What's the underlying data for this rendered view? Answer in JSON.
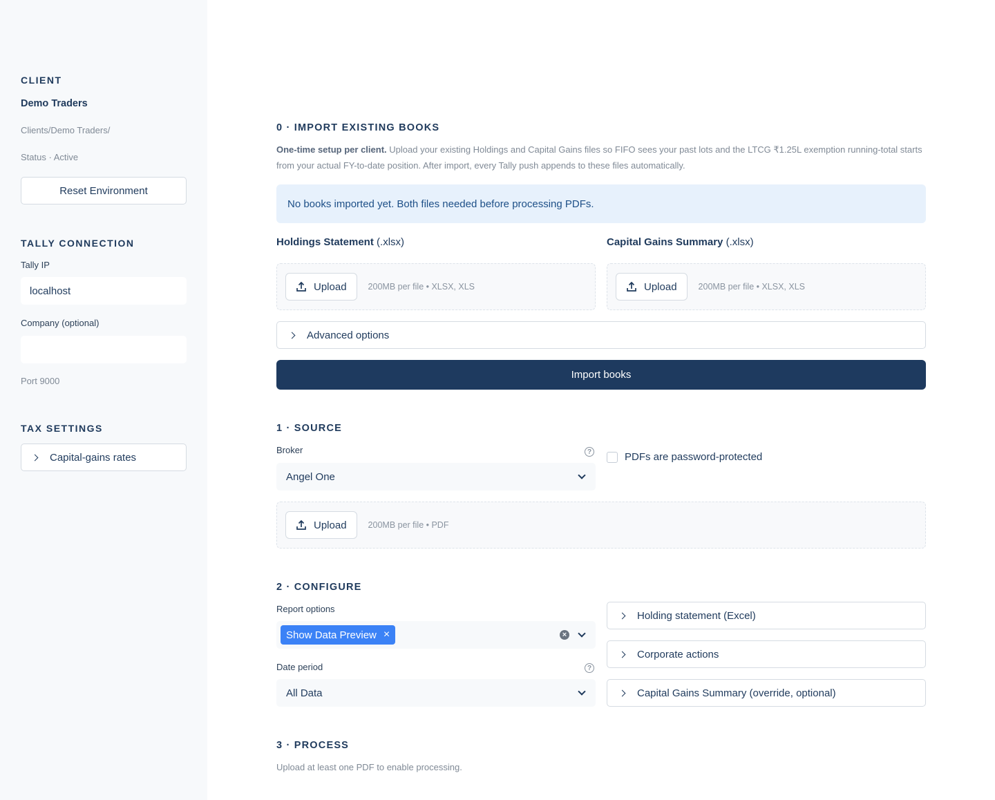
{
  "sidebar": {
    "client": {
      "heading": "CLIENT",
      "name": "Demo Traders",
      "path": "Clients/Demo Traders/",
      "status": "Status · Active",
      "reset_label": "Reset Environment"
    },
    "tally": {
      "heading": "TALLY CONNECTION",
      "ip_label": "Tally IP",
      "ip_value": "localhost",
      "company_label": "Company (optional)",
      "company_value": "",
      "port": "Port 9000"
    },
    "tax": {
      "heading": "TAX SETTINGS",
      "rates_label": "Capital-gains rates"
    }
  },
  "import_books": {
    "heading": "0 · IMPORT EXISTING BOOKS",
    "desc_bold": "One-time setup per client.",
    "desc_line1": " Upload your existing Holdings and Capital Gains files so FIFO sees your past lots and the LTCG ₹1.25L exemption running-total starts",
    "desc_line2": "from your actual FY-to-date position. After import, every Tally push appends to these files automatically.",
    "info": "No books imported yet. Both files needed before processing PDFs.",
    "holdings_label": "Holdings Statement",
    "holdings_ext": " (.xlsx)",
    "cg_label": "Capital Gains Summary",
    "cg_ext": " (.xlsx)",
    "upload_label": "Upload",
    "excel_hint": "200MB per file • XLSX, XLS",
    "advanced_label": "Advanced options",
    "import_button": "Import books"
  },
  "source": {
    "heading": "1 · SOURCE",
    "broker_label": "Broker",
    "broker_value": "Angel One",
    "password_label": "PDFs are password-protected",
    "upload_label": "Upload",
    "pdf_hint": "200MB per file • PDF"
  },
  "configure": {
    "heading": "2 · CONFIGURE",
    "report_label": "Report options",
    "report_tag": "Show Data Preview",
    "date_label": "Date period",
    "date_value": "All Data",
    "holding_expander": "Holding statement (Excel)",
    "corporate_expander": "Corporate actions",
    "cg_override_expander": "Capital Gains Summary (override, optional)"
  },
  "process": {
    "heading": "3 · PROCESS",
    "hint": "Upload at least one PDF to enable processing."
  }
}
